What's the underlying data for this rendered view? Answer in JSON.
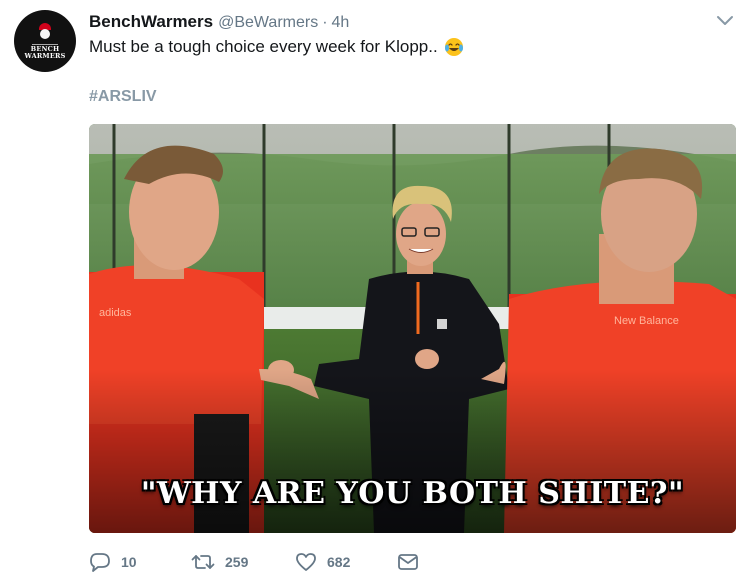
{
  "tweet": {
    "display_name": "BenchWarmers",
    "handle": "@BeWarmers",
    "separator": "·",
    "timestamp": "4h",
    "text": "Must be a tough choice every week for Klopp..",
    "emoji": "face-with-tears-of-joy",
    "hashtag": "#ARSLIV",
    "avatar_text": "BENCH WARMERS",
    "media": {
      "caption": "\"WHY ARE YOU BOTH SHITE?\"",
      "description_icons": [
        "player-left",
        "manager-center",
        "player-right"
      ]
    },
    "actions": {
      "reply_count": "10",
      "retweet_count": "259",
      "like_count": "682"
    }
  },
  "colors": {
    "text": "#14171a",
    "secondary": "#657786",
    "hashtag": "#8899a6",
    "jersey_red": "#e8321f"
  },
  "icons": {
    "caret": "chevron-down-icon",
    "reply": "reply-icon",
    "retweet": "retweet-icon",
    "like": "heart-icon",
    "dm": "envelope-icon"
  }
}
